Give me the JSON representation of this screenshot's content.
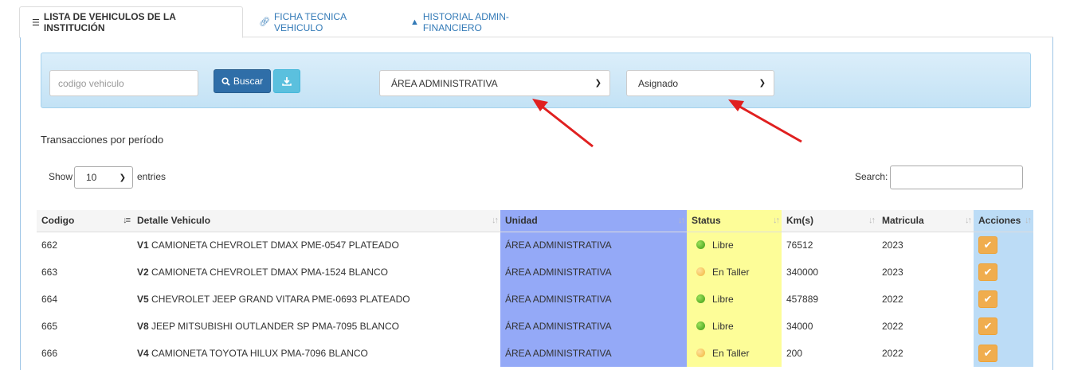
{
  "tabs": [
    {
      "label": "LISTA DE VEHICULOS DE LA INSTITUCIÓN",
      "icon": "list-icon",
      "active": true
    },
    {
      "label": "FICHA TECNICA VEHICULO",
      "icon": "link-icon",
      "active": false
    },
    {
      "label": "HISTORIAL ADMIN-FINANCIERO",
      "icon": "warning-icon",
      "active": false
    }
  ],
  "filters": {
    "code_placeholder": "codigo vehiculo",
    "search_button": "Buscar",
    "unit_selected": "ÁREA ADMINISTRATIVA",
    "status_selected": "Asignado"
  },
  "section_title": "Transacciones por período",
  "length_control": {
    "show_label": "Show",
    "value": "10",
    "entries_label": "entries"
  },
  "search_control": {
    "label": "Search:"
  },
  "table": {
    "headers": [
      "Codigo",
      "Detalle Vehiculo",
      "Unidad",
      "Status",
      "Km(s)",
      "Matricula",
      "Acciones"
    ],
    "rows": [
      {
        "codigo": "662",
        "detalle_code": "V1",
        "detalle": "CAMIONETA CHEVROLET DMAX PME-0547 PLATEADO",
        "unidad": "ÁREA ADMINISTRATIVA",
        "status": "Libre",
        "status_color": "green",
        "km": "76512",
        "matricula": "2023"
      },
      {
        "codigo": "663",
        "detalle_code": "V2",
        "detalle": "CAMIONETA CHEVROLET DMAX PMA-1524 BLANCO",
        "unidad": "ÁREA ADMINISTRATIVA",
        "status": "En Taller",
        "status_color": "amber",
        "km": "340000",
        "matricula": "2023"
      },
      {
        "codigo": "664",
        "detalle_code": "V5",
        "detalle": "CHEVROLET JEEP GRAND VITARA PME-0693 PLATEADO",
        "unidad": "ÁREA ADMINISTRATIVA",
        "status": "Libre",
        "status_color": "green",
        "km": "457889",
        "matricula": "2022"
      },
      {
        "codigo": "665",
        "detalle_code": "V8",
        "detalle": "JEEP MITSUBISHI OUTLANDER SP PMA-7095 BLANCO",
        "unidad": "ÁREA ADMINISTRATIVA",
        "status": "Libre",
        "status_color": "green",
        "km": "34000",
        "matricula": "2022"
      },
      {
        "codigo": "666",
        "detalle_code": "V4",
        "detalle": "CAMIONETA TOYOTA HILUX PMA-7096 BLANCO",
        "unidad": "ÁREA ADMINISTRATIVA",
        "status": "En Taller",
        "status_color": "amber",
        "km": "200",
        "matricula": "2022"
      }
    ]
  },
  "colors": {
    "unidad_column": "#94a9f7",
    "status_column": "#fdfd98",
    "acciones_column": "#bcdcf6",
    "primary_button": "#2f6ea8",
    "info_button": "#5bc0de",
    "action_button": "#f0ad4e",
    "annotation_arrow": "#e02020"
  }
}
